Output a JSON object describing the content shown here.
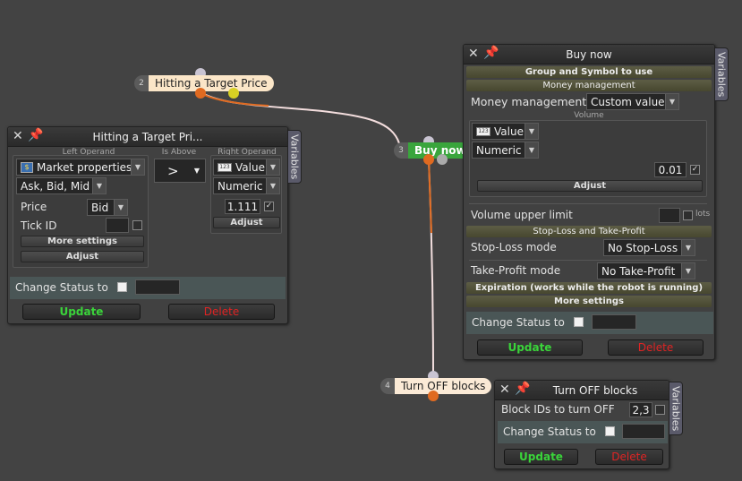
{
  "nodes": {
    "condition": {
      "num": "2",
      "label": "Hitting a Target Price"
    },
    "buy": {
      "num": "3",
      "label": "Buy now"
    },
    "off": {
      "num": "4",
      "label": "Turn OFF blocks"
    }
  },
  "condition_panel": {
    "title": "Hitting a Target Pri...",
    "variables_tab": "Variables",
    "left_operand_label": "Left Operand",
    "is_above_label": "Is Above",
    "right_operand_label": "Right Operand",
    "source": "Market properties",
    "source_icon": "market-properties-icon",
    "subtype": "Ask, Bid, Mid",
    "price_label": "Price",
    "price_value": "Bid",
    "tick_id_label": "Tick ID",
    "tick_id_value": "",
    "more_settings": "More settings",
    "adjust_left": "Adjust",
    "operator": ">",
    "right_source": "Value",
    "right_type": "Numeric",
    "right_value": "1.111",
    "right_checked": true,
    "adjust_right": "Adjust",
    "change_status_label": "Change Status to",
    "update": "Update",
    "delete": "Delete"
  },
  "buy_panel": {
    "title": "Buy now",
    "variables_tab": "Variables",
    "group_symbol": "Group and Symbol to use",
    "money_management_header": "Money management",
    "money_management_label": "Money management",
    "money_management_value": "Custom value",
    "volume_label": "Volume",
    "volume_source": "Value",
    "volume_type": "Numeric",
    "volume_value": "0.01",
    "volume_checked": true,
    "adjust": "Adjust",
    "volume_upper_limit_label": "Volume upper limit",
    "volume_upper_limit_unit": "lots",
    "sl_tp_header": "Stop-Loss and Take-Profit",
    "stop_loss_label": "Stop-Loss mode",
    "stop_loss_value": "No Stop-Loss",
    "take_profit_label": "Take-Profit mode",
    "take_profit_value": "No Take-Profit",
    "expiration": "Expiration (works while the robot is running)",
    "more_settings": "More settings",
    "change_status_label": "Change Status to",
    "update": "Update",
    "delete": "Delete"
  },
  "off_panel": {
    "title": "Turn OFF blocks",
    "variables_tab": "Variables",
    "block_ids_label": "Block IDs to turn OFF",
    "block_ids_value": "2,3",
    "change_status_label": "Change Status to",
    "update": "Update",
    "delete": "Delete"
  },
  "colors": {
    "background": "#434343",
    "wire_orange": "#e06a20",
    "wire_light": "#f2dede",
    "buy_green": "#39a53c",
    "update_green": "#3ad43a",
    "delete_red": "#e02424"
  }
}
